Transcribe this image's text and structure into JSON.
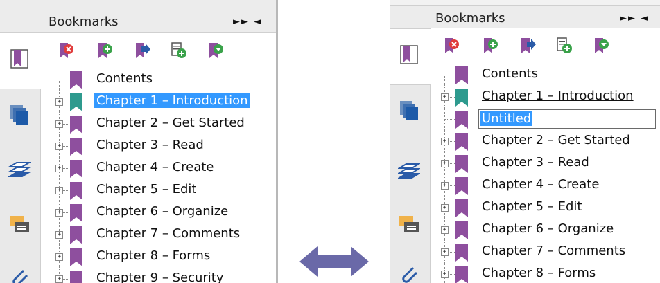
{
  "left_panel": {
    "title": "Bookmarks",
    "window_controls": "►► ◄",
    "selected_item": "Chapter 1 – Introduction",
    "bookmarks": [
      "Contents",
      "Chapter 1 – Introduction",
      "Chapter 2 – Get Started",
      "Chapter 3 – Read",
      "Chapter 4 – Create",
      "Chapter 5 – Edit",
      "Chapter 6 – Organize",
      "Chapter 7 – Comments",
      "Chapter 8 – Forms",
      "Chapter 9 – Security"
    ]
  },
  "right_panel": {
    "title": "Bookmarks",
    "window_controls": "►► ◄",
    "editing_value": "Untitled",
    "bookmarks": [
      "Contents",
      "Chapter 1 – Introduction",
      "Untitled",
      "Chapter 2 – Get Started",
      "Chapter 3 – Read",
      "Chapter 4 – Create",
      "Chapter 5 – Edit",
      "Chapter 6 – Organize",
      "Chapter 7 – Comments",
      "Chapter 8 – Forms"
    ]
  },
  "toolbar_icons": [
    "delete-bookmark-icon",
    "new-bookmark-icon",
    "expand-bookmark-icon",
    "new-bookmark-from-structure-icon",
    "bookmark-options-icon"
  ],
  "sidebar_icons": [
    "bookmarks-icon",
    "pages-icon",
    "layers-icon",
    "comments-icon",
    "attachments-icon"
  ],
  "colors": {
    "bookmark": "#8e4f9e",
    "bookmark_active": "#2e9a8e",
    "selection": "#3399ff",
    "arrow": "#6a69a8"
  }
}
